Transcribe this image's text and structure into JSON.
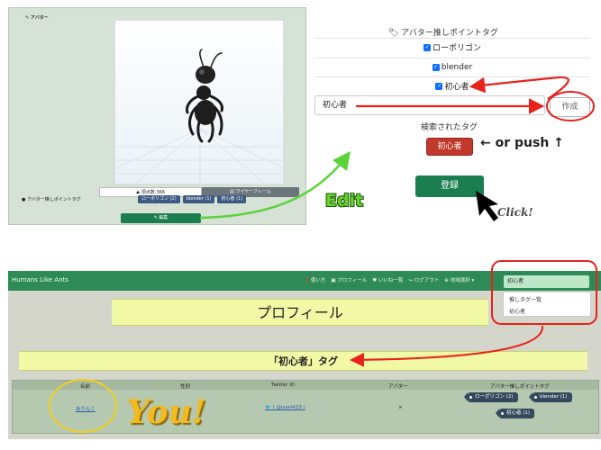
{
  "editor": {
    "title": "✎ アバター",
    "vertex_count": "⛰ 頂点数:366",
    "wireframe_button": "▤ ワイヤーフレーム",
    "tag_label": "● アバター推しポイントタグ",
    "mini_tags": [
      "ローポリゴン (2)",
      "blender (1)",
      "初心者 (1)"
    ],
    "edit_button": "✎ 編集"
  },
  "tag_form": {
    "title": "🏷 アバター推しポイントタグ",
    "checkboxes": [
      {
        "label": "ローポリゴン",
        "checked": true
      },
      {
        "label": "blender",
        "checked": true
      },
      {
        "label": "初心者",
        "checked": true
      }
    ],
    "input_value": "初心者",
    "create_button": "作成",
    "searched_title": "検索されたタグ",
    "searched_badge": "初心者",
    "register_button": "登録"
  },
  "annotations": {
    "edit": "Edit",
    "push": "← or push ↑",
    "click": "Click!",
    "you": "You!"
  },
  "site": {
    "brand": "Humans Like Ants",
    "nav_links": [
      "❓使い方",
      "▣ プロフィール",
      "♥ いいね一覧",
      "↪ ログアウト",
      "⊕ 地域選択 ▾"
    ],
    "select_value": "初心者",
    "dropdown_options": [
      "推しタグ一覧",
      "初心者"
    ],
    "profile_banner": "プロフィール",
    "tag_banner": "「初心者」タグ",
    "table_headers": [
      "名前",
      "性別",
      "Twitter ID",
      "アバター",
      "アバター推しポイントタグ"
    ],
    "row": {
      "name": "ありんこ",
      "gender": "",
      "twitter": "🐦 ( @issei423 )",
      "avatar": "×",
      "tags": [
        "ローポリゴン (2)",
        "blender (1)",
        "初心者 (1)"
      ]
    }
  },
  "colors": {
    "primary_green": "#1b7e4e",
    "navbar_green": "#2e8b57",
    "danger_red": "#c0392b",
    "annotation_red": "#e8221c",
    "annotation_green": "#5cd23a",
    "annotation_yellow": "#f2ba1f",
    "tag_navy": "#34495e"
  }
}
